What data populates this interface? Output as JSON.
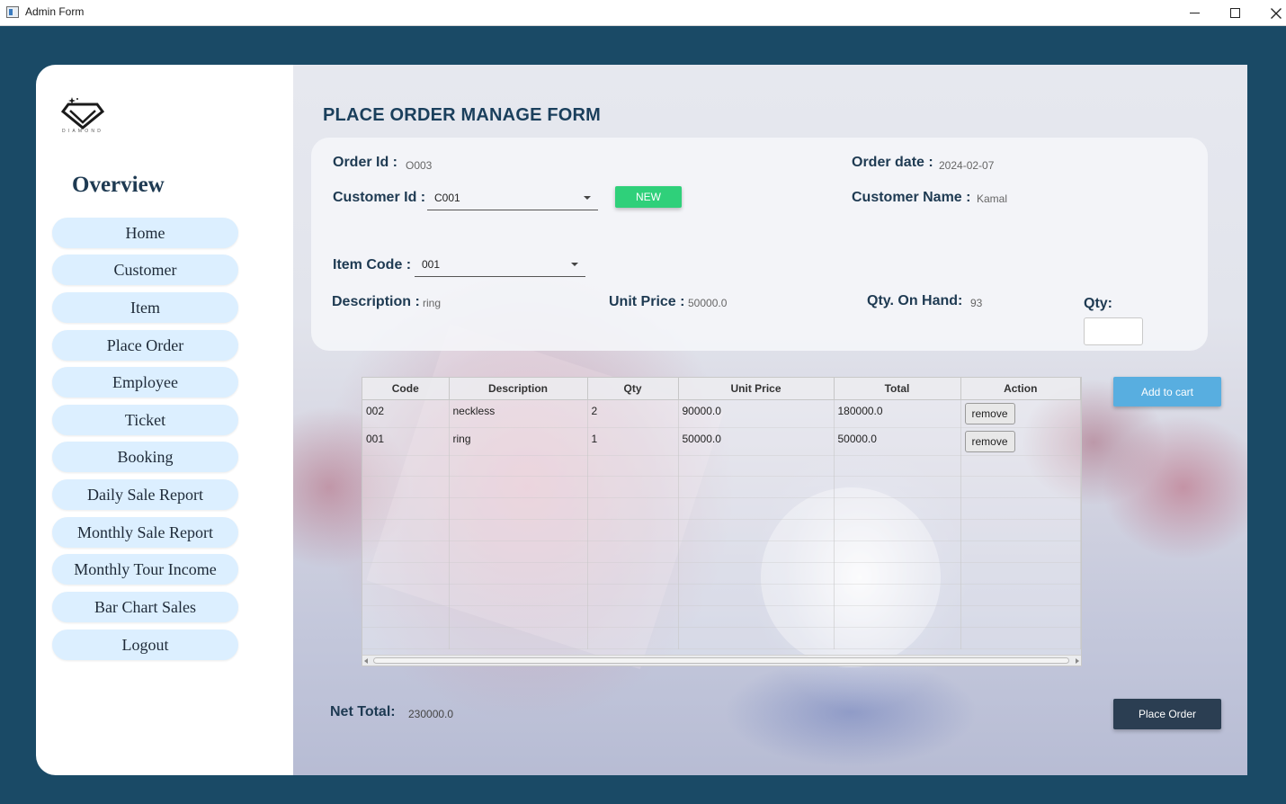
{
  "window": {
    "title": "Admin Form"
  },
  "sidebar": {
    "heading": "Overview",
    "items": [
      {
        "label": "Home"
      },
      {
        "label": "Customer"
      },
      {
        "label": "Item"
      },
      {
        "label": "Place Order"
      },
      {
        "label": "Employee"
      },
      {
        "label": "Ticket"
      },
      {
        "label": "Booking"
      },
      {
        "label": "Daily Sale Report"
      },
      {
        "label": "Monthly Sale Report"
      },
      {
        "label": "Monthly Tour Income"
      },
      {
        "label": "Bar Chart Sales"
      },
      {
        "label": "Logout"
      }
    ]
  },
  "form": {
    "title": "PLACE ORDER MANAGE FORM",
    "order_id_label": "Order Id :",
    "order_id_value": "O003",
    "order_date_label": "Order date :",
    "order_date_value": "2024-02-07",
    "customer_id_label": "Customer Id :",
    "customer_id_value": "C001",
    "new_button": "NEW",
    "customer_name_label": "Customer Name :",
    "customer_name_value": "Kamal",
    "item_code_label": "Item Code :",
    "item_code_value": "001",
    "description_label": "Description :",
    "description_value": "ring",
    "unit_price_label": "Unit Price :",
    "unit_price_value": "50000.0",
    "qty_on_hand_label": "Qty. On Hand:",
    "qty_on_hand_value": "93",
    "qty_label": "Qty:",
    "qty_value": ""
  },
  "cart": {
    "add_button": "Add to cart",
    "columns": [
      "Code",
      "Description",
      "Qty",
      "Unit Price",
      "Total",
      "Action"
    ],
    "rows": [
      {
        "code": "002",
        "description": "neckless",
        "qty": "2",
        "unit_price": "90000.0",
        "total": "180000.0",
        "action": "remove"
      },
      {
        "code": "001",
        "description": "ring",
        "qty": "1",
        "unit_price": "50000.0",
        "total": "50000.0",
        "action": "remove"
      }
    ]
  },
  "footer": {
    "net_total_label": "Net Total:",
    "net_total_value": "230000.0",
    "place_order_button": "Place Order"
  },
  "colors": {
    "window_bg": "#1a4a66",
    "nav_button_bg": "#dcefff",
    "new_button": "#2fd07a",
    "add_to_cart": "#58aee0",
    "place_order": "#2b3e52",
    "heading_text": "#1e3a52"
  },
  "icons": {
    "app": "window-app-icon",
    "logo": "diamond-logo-icon"
  }
}
